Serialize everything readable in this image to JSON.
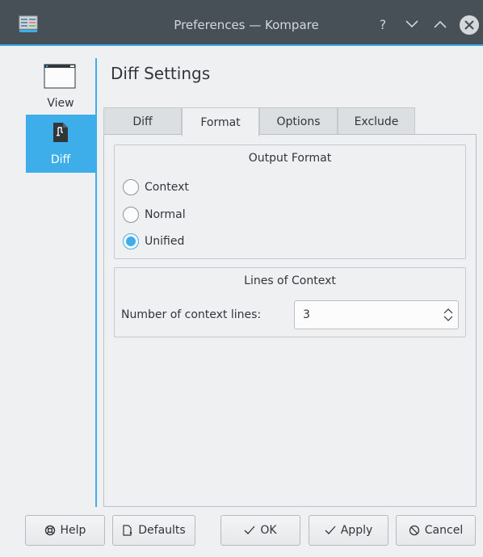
{
  "window": {
    "title": "Preferences — Kompare",
    "help_glyph": "?"
  },
  "sidebar": {
    "items": [
      {
        "label": "View",
        "icon": "view-window-icon",
        "selected": false
      },
      {
        "label": "Diff",
        "icon": "diff-document-icon",
        "selected": true
      }
    ]
  },
  "page": {
    "title": "Diff Settings"
  },
  "tabs": [
    {
      "label": "Diff",
      "active": false
    },
    {
      "label": "Format",
      "active": true
    },
    {
      "label": "Options",
      "active": false
    },
    {
      "label": "Exclude",
      "active": false
    }
  ],
  "output_format": {
    "title": "Output Format",
    "options": [
      {
        "label": "Context",
        "checked": false
      },
      {
        "label": "Normal",
        "checked": false
      },
      {
        "label": "Unified",
        "checked": true
      }
    ]
  },
  "lines_of_context": {
    "title": "Lines of Context",
    "label": "Number of context lines:",
    "value": "3"
  },
  "buttons": {
    "help": "Help",
    "defaults": "Defaults",
    "ok": "OK",
    "apply": "Apply",
    "cancel": "Cancel"
  },
  "colors": {
    "accent": "#3daee9",
    "titlebar": "#475057",
    "background": "#eff0f1"
  }
}
